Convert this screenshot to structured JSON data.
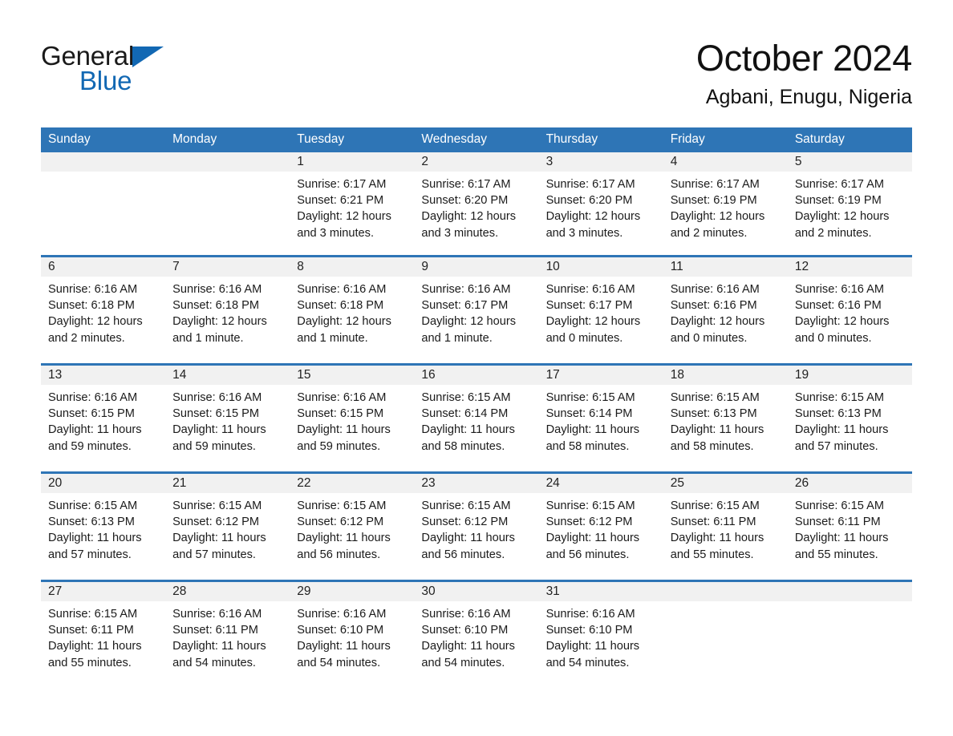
{
  "brand": {
    "line1": "General",
    "line2": "Blue",
    "triangle_icon": "brand-triangle-icon",
    "accent_color": "#1268b3"
  },
  "header": {
    "title": "October 2024",
    "subtitle": "Agbani, Enugu, Nigeria"
  },
  "theme": {
    "header_blue": "#2e75b6",
    "daynum_gray": "#f1f1f1",
    "separator_blue": "#2e75b6",
    "text": "#1b1b1b"
  },
  "weekday_headers": [
    "Sunday",
    "Monday",
    "Tuesday",
    "Wednesday",
    "Thursday",
    "Friday",
    "Saturday"
  ],
  "labels": {
    "sunrise_prefix": "Sunrise:",
    "sunset_prefix": "Sunset:",
    "daylight_prefix": "Daylight:"
  },
  "weeks": [
    {
      "days": [
        {
          "num": "",
          "empty": true,
          "sunrise": "",
          "sunset": "",
          "daylight": ""
        },
        {
          "num": "",
          "empty": true,
          "sunrise": "",
          "sunset": "",
          "daylight": ""
        },
        {
          "num": "1",
          "empty": false,
          "sunrise": "Sunrise: 6:17 AM",
          "sunset": "Sunset: 6:21 PM",
          "daylight": "Daylight: 12 hours and 3 minutes."
        },
        {
          "num": "2",
          "empty": false,
          "sunrise": "Sunrise: 6:17 AM",
          "sunset": "Sunset: 6:20 PM",
          "daylight": "Daylight: 12 hours and 3 minutes."
        },
        {
          "num": "3",
          "empty": false,
          "sunrise": "Sunrise: 6:17 AM",
          "sunset": "Sunset: 6:20 PM",
          "daylight": "Daylight: 12 hours and 3 minutes."
        },
        {
          "num": "4",
          "empty": false,
          "sunrise": "Sunrise: 6:17 AM",
          "sunset": "Sunset: 6:19 PM",
          "daylight": "Daylight: 12 hours and 2 minutes."
        },
        {
          "num": "5",
          "empty": false,
          "sunrise": "Sunrise: 6:17 AM",
          "sunset": "Sunset: 6:19 PM",
          "daylight": "Daylight: 12 hours and 2 minutes."
        }
      ]
    },
    {
      "days": [
        {
          "num": "6",
          "empty": false,
          "sunrise": "Sunrise: 6:16 AM",
          "sunset": "Sunset: 6:18 PM",
          "daylight": "Daylight: 12 hours and 2 minutes."
        },
        {
          "num": "7",
          "empty": false,
          "sunrise": "Sunrise: 6:16 AM",
          "sunset": "Sunset: 6:18 PM",
          "daylight": "Daylight: 12 hours and 1 minute."
        },
        {
          "num": "8",
          "empty": false,
          "sunrise": "Sunrise: 6:16 AM",
          "sunset": "Sunset: 6:18 PM",
          "daylight": "Daylight: 12 hours and 1 minute."
        },
        {
          "num": "9",
          "empty": false,
          "sunrise": "Sunrise: 6:16 AM",
          "sunset": "Sunset: 6:17 PM",
          "daylight": "Daylight: 12 hours and 1 minute."
        },
        {
          "num": "10",
          "empty": false,
          "sunrise": "Sunrise: 6:16 AM",
          "sunset": "Sunset: 6:17 PM",
          "daylight": "Daylight: 12 hours and 0 minutes."
        },
        {
          "num": "11",
          "empty": false,
          "sunrise": "Sunrise: 6:16 AM",
          "sunset": "Sunset: 6:16 PM",
          "daylight": "Daylight: 12 hours and 0 minutes."
        },
        {
          "num": "12",
          "empty": false,
          "sunrise": "Sunrise: 6:16 AM",
          "sunset": "Sunset: 6:16 PM",
          "daylight": "Daylight: 12 hours and 0 minutes."
        }
      ]
    },
    {
      "days": [
        {
          "num": "13",
          "empty": false,
          "sunrise": "Sunrise: 6:16 AM",
          "sunset": "Sunset: 6:15 PM",
          "daylight": "Daylight: 11 hours and 59 minutes."
        },
        {
          "num": "14",
          "empty": false,
          "sunrise": "Sunrise: 6:16 AM",
          "sunset": "Sunset: 6:15 PM",
          "daylight": "Daylight: 11 hours and 59 minutes."
        },
        {
          "num": "15",
          "empty": false,
          "sunrise": "Sunrise: 6:16 AM",
          "sunset": "Sunset: 6:15 PM",
          "daylight": "Daylight: 11 hours and 59 minutes."
        },
        {
          "num": "16",
          "empty": false,
          "sunrise": "Sunrise: 6:15 AM",
          "sunset": "Sunset: 6:14 PM",
          "daylight": "Daylight: 11 hours and 58 minutes."
        },
        {
          "num": "17",
          "empty": false,
          "sunrise": "Sunrise: 6:15 AM",
          "sunset": "Sunset: 6:14 PM",
          "daylight": "Daylight: 11 hours and 58 minutes."
        },
        {
          "num": "18",
          "empty": false,
          "sunrise": "Sunrise: 6:15 AM",
          "sunset": "Sunset: 6:13 PM",
          "daylight": "Daylight: 11 hours and 58 minutes."
        },
        {
          "num": "19",
          "empty": false,
          "sunrise": "Sunrise: 6:15 AM",
          "sunset": "Sunset: 6:13 PM",
          "daylight": "Daylight: 11 hours and 57 minutes."
        }
      ]
    },
    {
      "days": [
        {
          "num": "20",
          "empty": false,
          "sunrise": "Sunrise: 6:15 AM",
          "sunset": "Sunset: 6:13 PM",
          "daylight": "Daylight: 11 hours and 57 minutes."
        },
        {
          "num": "21",
          "empty": false,
          "sunrise": "Sunrise: 6:15 AM",
          "sunset": "Sunset: 6:12 PM",
          "daylight": "Daylight: 11 hours and 57 minutes."
        },
        {
          "num": "22",
          "empty": false,
          "sunrise": "Sunrise: 6:15 AM",
          "sunset": "Sunset: 6:12 PM",
          "daylight": "Daylight: 11 hours and 56 minutes."
        },
        {
          "num": "23",
          "empty": false,
          "sunrise": "Sunrise: 6:15 AM",
          "sunset": "Sunset: 6:12 PM",
          "daylight": "Daylight: 11 hours and 56 minutes."
        },
        {
          "num": "24",
          "empty": false,
          "sunrise": "Sunrise: 6:15 AM",
          "sunset": "Sunset: 6:12 PM",
          "daylight": "Daylight: 11 hours and 56 minutes."
        },
        {
          "num": "25",
          "empty": false,
          "sunrise": "Sunrise: 6:15 AM",
          "sunset": "Sunset: 6:11 PM",
          "daylight": "Daylight: 11 hours and 55 minutes."
        },
        {
          "num": "26",
          "empty": false,
          "sunrise": "Sunrise: 6:15 AM",
          "sunset": "Sunset: 6:11 PM",
          "daylight": "Daylight: 11 hours and 55 minutes."
        }
      ]
    },
    {
      "days": [
        {
          "num": "27",
          "empty": false,
          "sunrise": "Sunrise: 6:15 AM",
          "sunset": "Sunset: 6:11 PM",
          "daylight": "Daylight: 11 hours and 55 minutes."
        },
        {
          "num": "28",
          "empty": false,
          "sunrise": "Sunrise: 6:16 AM",
          "sunset": "Sunset: 6:11 PM",
          "daylight": "Daylight: 11 hours and 54 minutes."
        },
        {
          "num": "29",
          "empty": false,
          "sunrise": "Sunrise: 6:16 AM",
          "sunset": "Sunset: 6:10 PM",
          "daylight": "Daylight: 11 hours and 54 minutes."
        },
        {
          "num": "30",
          "empty": false,
          "sunrise": "Sunrise: 6:16 AM",
          "sunset": "Sunset: 6:10 PM",
          "daylight": "Daylight: 11 hours and 54 minutes."
        },
        {
          "num": "31",
          "empty": false,
          "sunrise": "Sunrise: 6:16 AM",
          "sunset": "Sunset: 6:10 PM",
          "daylight": "Daylight: 11 hours and 54 minutes."
        },
        {
          "num": "",
          "empty": true,
          "sunrise": "",
          "sunset": "",
          "daylight": ""
        },
        {
          "num": "",
          "empty": true,
          "sunrise": "",
          "sunset": "",
          "daylight": ""
        }
      ]
    }
  ]
}
